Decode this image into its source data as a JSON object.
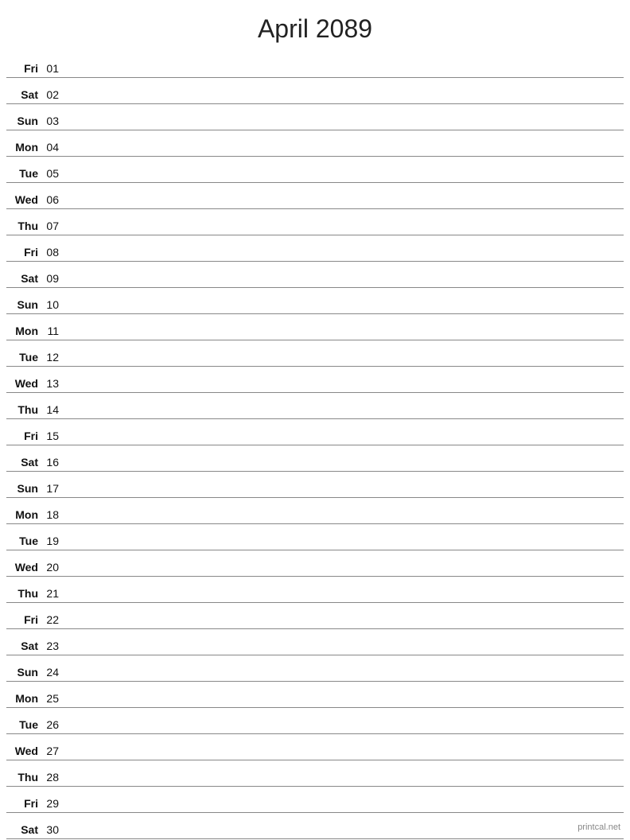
{
  "title": "April 2089",
  "footer": "printcal.net",
  "days": [
    {
      "name": "Fri",
      "num": "01"
    },
    {
      "name": "Sat",
      "num": "02"
    },
    {
      "name": "Sun",
      "num": "03"
    },
    {
      "name": "Mon",
      "num": "04"
    },
    {
      "name": "Tue",
      "num": "05"
    },
    {
      "name": "Wed",
      "num": "06"
    },
    {
      "name": "Thu",
      "num": "07"
    },
    {
      "name": "Fri",
      "num": "08"
    },
    {
      "name": "Sat",
      "num": "09"
    },
    {
      "name": "Sun",
      "num": "10"
    },
    {
      "name": "Mon",
      "num": "11"
    },
    {
      "name": "Tue",
      "num": "12"
    },
    {
      "name": "Wed",
      "num": "13"
    },
    {
      "name": "Thu",
      "num": "14"
    },
    {
      "name": "Fri",
      "num": "15"
    },
    {
      "name": "Sat",
      "num": "16"
    },
    {
      "name": "Sun",
      "num": "17"
    },
    {
      "name": "Mon",
      "num": "18"
    },
    {
      "name": "Tue",
      "num": "19"
    },
    {
      "name": "Wed",
      "num": "20"
    },
    {
      "name": "Thu",
      "num": "21"
    },
    {
      "name": "Fri",
      "num": "22"
    },
    {
      "name": "Sat",
      "num": "23"
    },
    {
      "name": "Sun",
      "num": "24"
    },
    {
      "name": "Mon",
      "num": "25"
    },
    {
      "name": "Tue",
      "num": "26"
    },
    {
      "name": "Wed",
      "num": "27"
    },
    {
      "name": "Thu",
      "num": "28"
    },
    {
      "name": "Fri",
      "num": "29"
    },
    {
      "name": "Sat",
      "num": "30"
    }
  ]
}
